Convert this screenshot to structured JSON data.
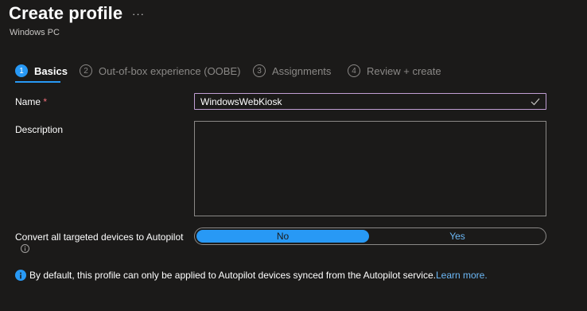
{
  "header": {
    "title": "Create profile",
    "more_glyph": "···",
    "subtitle": "Windows PC"
  },
  "steps": [
    {
      "number": "1",
      "label": "Basics",
      "state": "active"
    },
    {
      "number": "2",
      "label": "Out-of-box experience (OOBE)",
      "state": "inactive"
    },
    {
      "number": "3",
      "label": "Assignments",
      "state": "inactive"
    },
    {
      "number": "4",
      "label": "Review + create",
      "state": "inactive"
    }
  ],
  "form": {
    "name_label": "Name",
    "required_marker": "*",
    "name_value": "WindowsWebKiosk",
    "description_label": "Description",
    "description_value": "",
    "autopilot_label": "Convert all targeted devices to Autopilot",
    "autopilot_options": {
      "no": "No",
      "yes": "Yes"
    },
    "autopilot_selected": "No"
  },
  "info_note": {
    "text": "By default, this profile can only be applied to Autopilot devices synced from the Autopilot service.",
    "link": "Learn more."
  },
  "colors": {
    "background": "#1b1a19",
    "accent": "#2899f5",
    "link": "#6cb8f6",
    "input_focus_border": "#c19fd4",
    "required": "#f1707b"
  }
}
